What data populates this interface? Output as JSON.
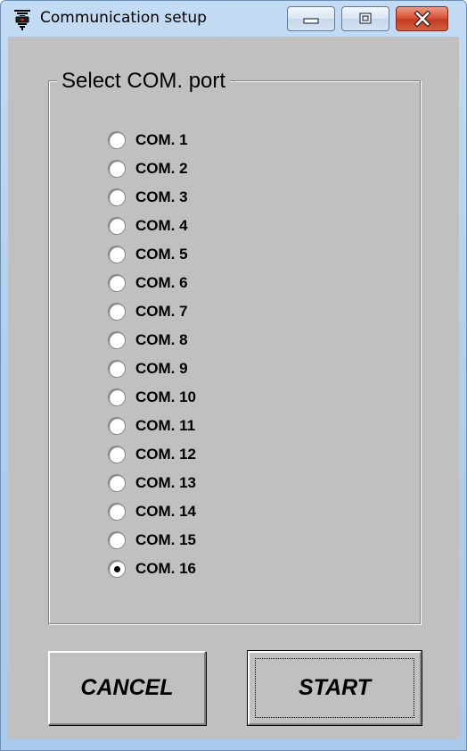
{
  "window": {
    "title": "Communication setup",
    "icon": "plug-connector-icon",
    "caption_buttons": [
      "minimize-icon",
      "maximize-icon",
      "close-icon"
    ]
  },
  "group": {
    "legend": "Select COM. port"
  },
  "ports": [
    {
      "label": "COM. 1",
      "selected": false
    },
    {
      "label": "COM. 2",
      "selected": false
    },
    {
      "label": "COM. 3",
      "selected": false
    },
    {
      "label": "COM. 4",
      "selected": false
    },
    {
      "label": "COM. 5",
      "selected": false
    },
    {
      "label": "COM. 6",
      "selected": false
    },
    {
      "label": "COM. 7",
      "selected": false
    },
    {
      "label": "COM. 8",
      "selected": false
    },
    {
      "label": "COM. 9",
      "selected": false
    },
    {
      "label": "COM. 10",
      "selected": false
    },
    {
      "label": "COM. 11",
      "selected": false
    },
    {
      "label": "COM. 12",
      "selected": false
    },
    {
      "label": "COM. 13",
      "selected": false
    },
    {
      "label": "COM. 14",
      "selected": false
    },
    {
      "label": "COM. 15",
      "selected": false
    },
    {
      "label": "COM. 16",
      "selected": true
    }
  ],
  "buttons": {
    "cancel_label": "CANCEL",
    "start_label": "START"
  },
  "colors": {
    "dialog_face": "#c0c0c0",
    "close_button": "#c94a2f",
    "titlebar": "#b9d3ee"
  }
}
